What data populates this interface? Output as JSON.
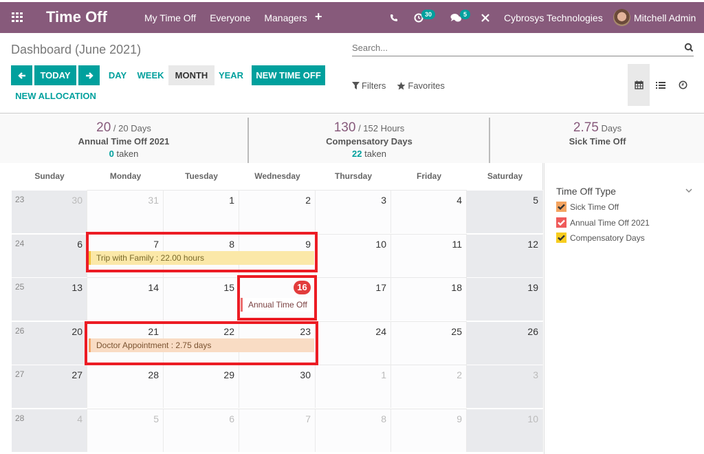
{
  "navbar": {
    "app_title": "Time Off",
    "menu": [
      "My Time Off",
      "Everyone",
      "Managers"
    ],
    "plus": "+",
    "activity_count": "30",
    "message_count": "5",
    "company": "Cybrosys Technologies",
    "user": "Mitchell Admin",
    "icons": [
      "apps-icon",
      "phone-icon",
      "activity-clock-icon",
      "chat-icon",
      "debug-tools-icon",
      "avatar"
    ]
  },
  "control_panel": {
    "breadcrumb": "Dashboard (June 2021)",
    "search_placeholder": "Search...",
    "buttons": {
      "prev": "←",
      "today": "Today",
      "next": "→",
      "day": "Day",
      "week": "Week",
      "month": "Month",
      "year": "Year",
      "new_time_off": "New Time Off",
      "new_allocation": "New Allocation"
    },
    "active_scale": "Month",
    "filters_label": "Filters",
    "favorites_label": "Favorites",
    "views": [
      "calendar-view",
      "list-view",
      "activity-view"
    ],
    "active_view": "calendar-view"
  },
  "summary": [
    {
      "value": "20",
      "suffix": "/ 20 Days",
      "name": "Annual Time Off 2021",
      "taken_value": "0",
      "taken_label": "taken"
    },
    {
      "value": "130",
      "suffix": "/ 152 Hours",
      "name": "Compensatory Days",
      "taken_value": "22",
      "taken_label": "taken"
    },
    {
      "value": "2.75",
      "suffix": "Days",
      "name": "Sick Time Off",
      "taken_value": null,
      "taken_label": null
    }
  ],
  "calendar": {
    "weekdays": [
      "Sunday",
      "Monday",
      "Tuesday",
      "Wednesday",
      "Thursday",
      "Friday",
      "Saturday"
    ],
    "weeks": [
      {
        "week_no": "23",
        "days": [
          {
            "d": "30",
            "other": true
          },
          {
            "d": "31",
            "other": true
          },
          {
            "d": "1"
          },
          {
            "d": "2"
          },
          {
            "d": "3"
          },
          {
            "d": "4"
          },
          {
            "d": "5"
          }
        ]
      },
      {
        "week_no": "24",
        "days": [
          {
            "d": "6"
          },
          {
            "d": "7"
          },
          {
            "d": "8"
          },
          {
            "d": "9"
          },
          {
            "d": "10"
          },
          {
            "d": "11"
          },
          {
            "d": "12"
          }
        ]
      },
      {
        "week_no": "25",
        "days": [
          {
            "d": "13"
          },
          {
            "d": "14"
          },
          {
            "d": "15"
          },
          {
            "d": "16",
            "today": true
          },
          {
            "d": "17"
          },
          {
            "d": "18"
          },
          {
            "d": "19"
          }
        ]
      },
      {
        "week_no": "26",
        "days": [
          {
            "d": "20"
          },
          {
            "d": "21"
          },
          {
            "d": "22"
          },
          {
            "d": "23"
          },
          {
            "d": "24"
          },
          {
            "d": "25"
          },
          {
            "d": "26"
          }
        ]
      },
      {
        "week_no": "27",
        "days": [
          {
            "d": "27"
          },
          {
            "d": "28"
          },
          {
            "d": "29"
          },
          {
            "d": "30"
          },
          {
            "d": "1",
            "other": true
          },
          {
            "d": "2",
            "other": true
          },
          {
            "d": "3",
            "other": true
          }
        ]
      },
      {
        "week_no": "28",
        "days": [
          {
            "d": "4",
            "other": true
          },
          {
            "d": "5",
            "other": true
          },
          {
            "d": "6",
            "other": true
          },
          {
            "d": "7",
            "other": true
          },
          {
            "d": "8",
            "other": true
          },
          {
            "d": "9",
            "other": true
          },
          {
            "d": "10",
            "other": true
          }
        ]
      }
    ],
    "events": [
      {
        "label": "Trip with Family : 22.00 hours",
        "type": "Compensatory Days",
        "dates": "June 7–9"
      },
      {
        "label": "Annual Time Off",
        "type": "Annual Time Off 2021",
        "dates": "June 16"
      },
      {
        "label": "Doctor Appointment : 2.75 days",
        "type": "Sick Time Off",
        "dates": "June 21–23"
      }
    ]
  },
  "sidebar": {
    "title": "Time Off Type",
    "filters": [
      {
        "label": "Sick Time Off",
        "color": "#f4a460",
        "checked": true,
        "check_color": "#333"
      },
      {
        "label": "Annual Time Off 2021",
        "color": "#ef5b5b",
        "checked": true,
        "check_color": "#fff"
      },
      {
        "label": "Compensatory Days",
        "color": "#f7cd1f",
        "checked": true,
        "check_color": "#333"
      }
    ]
  },
  "colors": {
    "brand": "#875a7b",
    "primary": "#00a09d",
    "today": "#e23c3c",
    "highlight": "#ec1c24"
  }
}
